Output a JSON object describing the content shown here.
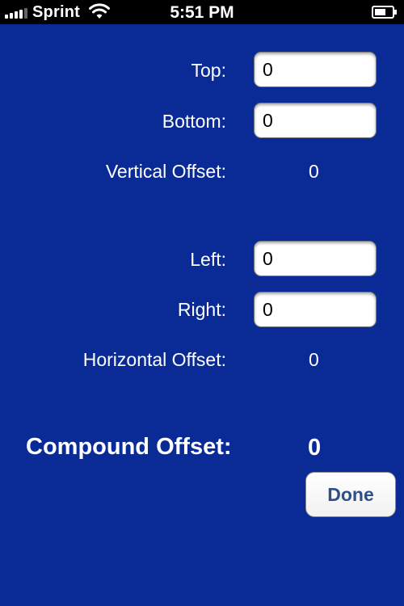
{
  "status_bar": {
    "carrier": "Sprint",
    "time": "5:51 PM",
    "signal_icon": "signal-bars-icon",
    "wifi_icon": "wifi-icon",
    "battery_icon": "battery-icon"
  },
  "vertical": {
    "top_label": "Top:",
    "top_value": "0",
    "bottom_label": "Bottom:",
    "bottom_value": "0",
    "offset_label": "Vertical Offset:",
    "offset_value": "0"
  },
  "horizontal": {
    "left_label": "Left:",
    "left_value": "0",
    "right_label": "Right:",
    "right_value": "0",
    "offset_label": "Horizontal Offset:",
    "offset_value": "0"
  },
  "compound": {
    "label": "Compound Offset:",
    "value": "0"
  },
  "done_label": "Done",
  "colors": {
    "background": "#0a2b96",
    "status_bar": "#000000",
    "button_text": "#2f4f8a"
  }
}
